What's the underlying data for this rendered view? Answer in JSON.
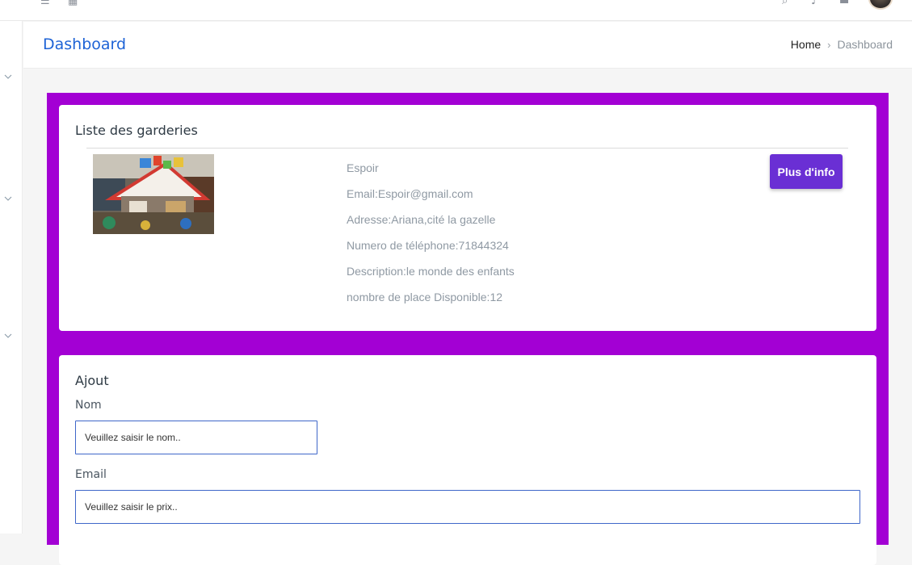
{
  "header": {
    "title": "Dashboard",
    "breadcrumb": {
      "home": "Home",
      "separator": "›",
      "current": "Dashboard"
    }
  },
  "topbar": {
    "icons": [
      "menu-icon",
      "grid-icon",
      "search-icon",
      "bell-icon",
      "mail-icon"
    ]
  },
  "sidebar": {
    "chevrons": [
      "chevron-down-icon",
      "chevron-down-icon",
      "chevron-down-icon"
    ]
  },
  "list_card": {
    "title": "Liste des garderies",
    "item": {
      "name": "Espoir",
      "email": "Email:Espoir@gmail.com",
      "address": "Adresse:Ariana,cité la gazelle",
      "phone": "Numero de téléphone:71844324",
      "description": "Description:le monde des enfants",
      "places": "nombre de place Disponible:12",
      "more_button": "Plus d'info"
    }
  },
  "form_card": {
    "title": "Ajout",
    "name_label": "Nom",
    "name_placeholder": "Veuillez saisir le nom..",
    "email_label": "Email",
    "email_placeholder": "Veuillez saisir le prix.."
  },
  "colors": {
    "accent_purple": "#a300d4",
    "button_purple": "#6a2fd4",
    "title_blue": "#1e63d6"
  }
}
